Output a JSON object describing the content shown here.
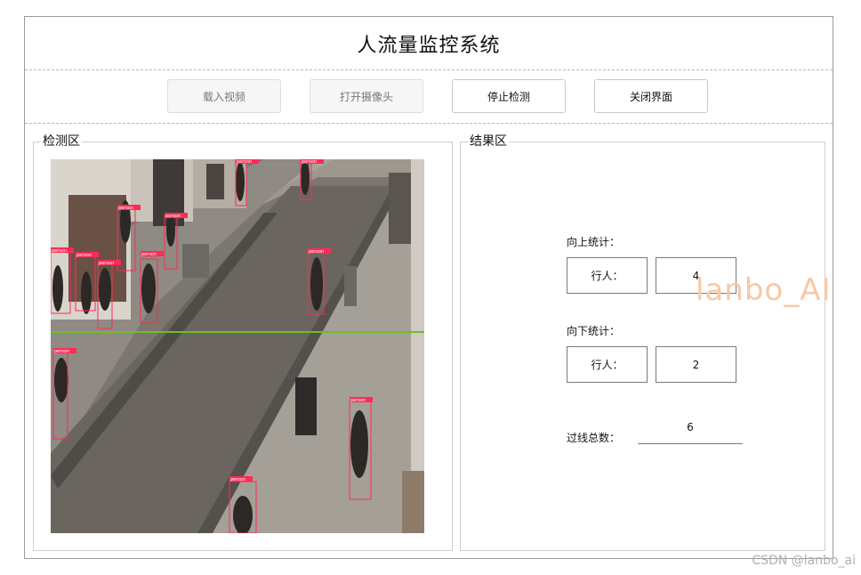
{
  "title": "人流量监控系统",
  "toolbar": {
    "load_video": "载入视频",
    "open_camera": "打开摄像头",
    "stop_detection": "停止检测",
    "close_window": "关闭界面"
  },
  "detection_panel": {
    "label": "检测区",
    "boxes": [
      "person",
      "person",
      "person",
      "person",
      "person",
      "person",
      "person",
      "person",
      "person",
      "person",
      "person",
      "person"
    ]
  },
  "result_panel": {
    "label": "结果区",
    "up": {
      "title": "向上统计：",
      "pedestrian_label": "行人：",
      "pedestrian_count": "4"
    },
    "down": {
      "title": "向下统计：",
      "pedestrian_label": "行人：",
      "pedestrian_count": "2"
    },
    "total": {
      "label": "过线总数：",
      "value": "6"
    }
  },
  "watermark": "lanbo_AI",
  "credit": "CSDN @lanbo_ai",
  "colors": {
    "bbox": "#ff2a55",
    "counting_line": "#6cbf2a",
    "watermark": "#f6c9a8"
  }
}
